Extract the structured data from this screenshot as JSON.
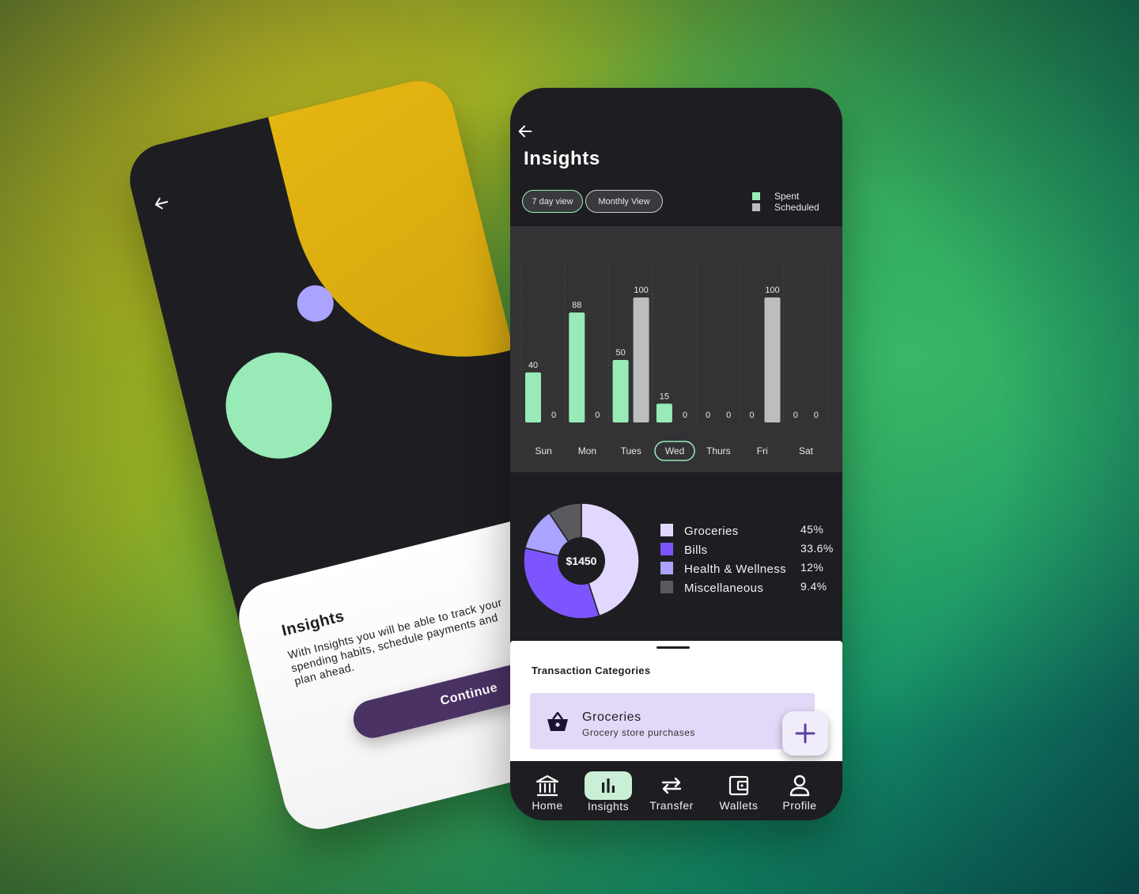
{
  "intro_screen": {
    "title": "Insights",
    "body": "With Insights you will be able to track your spending habits, schedule payments and plan ahead.",
    "continue_label": "Continue",
    "back_icon": "arrow-left-icon"
  },
  "insights_screen": {
    "title": "Insights",
    "back_icon": "arrow-left-icon",
    "view_toggle": [
      {
        "label": "7 day view",
        "selected": true
      },
      {
        "label": "Monthly View",
        "selected": false
      }
    ],
    "legend": [
      {
        "label": "Spent",
        "color": "#98ebb6"
      },
      {
        "label": "Scheduled",
        "color": "#bdbdbd"
      }
    ],
    "selected_day": "Wed",
    "total": "$1450",
    "categories": [
      {
        "name": "Groceries",
        "percent": "45%",
        "color": "#e2d8ff"
      },
      {
        "name": "Bills",
        "percent": "33.6%",
        "color": "#7d55ff"
      },
      {
        "name": "Health & Wellness",
        "percent": "12%",
        "color": "#aaa3ff"
      },
      {
        "name": "Miscellaneous",
        "percent": "9.4%",
        "color": "#5a5a5e"
      }
    ],
    "transaction_sheet": {
      "title": "Transaction Categories",
      "item": {
        "name": "Groceries",
        "description": "Grocery store purchases",
        "icon": "basket-icon"
      },
      "add_icon": "plus-icon"
    },
    "nav": [
      {
        "label": "Home",
        "icon": "bank-icon",
        "active": false
      },
      {
        "label": "Insights",
        "icon": "bar-chart-icon",
        "active": true
      },
      {
        "label": "Transfer",
        "icon": "swap-arrows-icon",
        "active": false
      },
      {
        "label": "Wallets",
        "icon": "wallet-icon",
        "active": false
      },
      {
        "label": "Profile",
        "icon": "person-icon",
        "active": false
      }
    ]
  },
  "chart_data": [
    {
      "type": "bar",
      "categories": [
        "Sun",
        "Mon",
        "Tues",
        "Wed",
        "Thurs",
        "Fri",
        "Sat"
      ],
      "series": [
        {
          "name": "Spent",
          "values": [
            40,
            88,
            50,
            15,
            0,
            0,
            0
          ],
          "color": "#98ebb6"
        },
        {
          "name": "Scheduled",
          "values": [
            0,
            0,
            100,
            0,
            0,
            100,
            0
          ],
          "color": "#bdbdbd"
        }
      ],
      "ylim": [
        0,
        100
      ],
      "grid": true
    },
    {
      "type": "pie",
      "categories": [
        "Groceries",
        "Bills",
        "Health & Wellness",
        "Miscellaneous"
      ],
      "values": [
        45,
        33.6,
        12,
        9.4
      ]
    }
  ]
}
